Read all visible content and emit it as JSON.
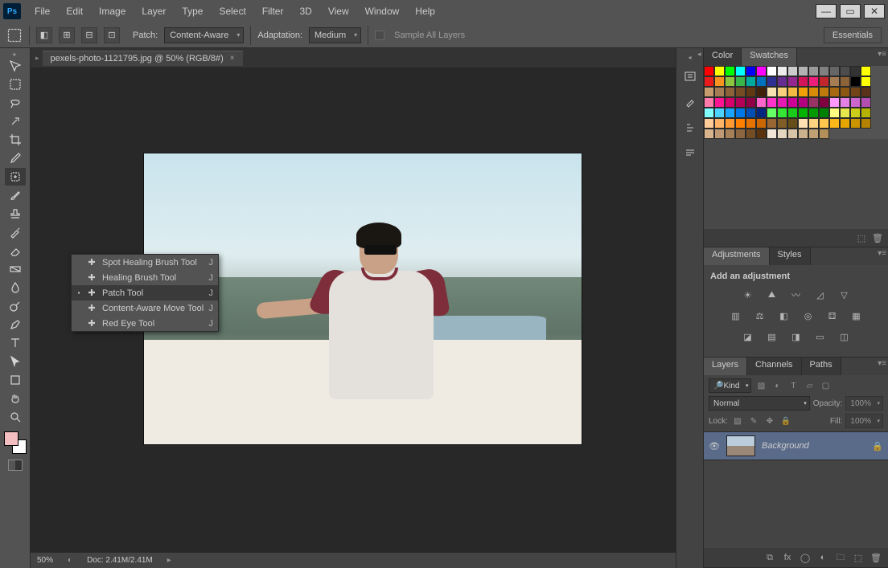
{
  "app": {
    "logo_text": "Ps"
  },
  "menubar": [
    "File",
    "Edit",
    "Image",
    "Layer",
    "Type",
    "Select",
    "Filter",
    "3D",
    "View",
    "Window",
    "Help"
  ],
  "options": {
    "patch_label": "Patch:",
    "patch_value": "Content-Aware",
    "adapt_label": "Adaptation:",
    "adapt_value": "Medium",
    "sample_all_label": "Sample All Layers",
    "essentials": "Essentials"
  },
  "document": {
    "tab_title": "pexels-photo-1121795.jpg @ 50% (RGB/8#)"
  },
  "tool_flyout": {
    "items": [
      {
        "label": "Spot Healing Brush Tool",
        "key": "J",
        "selected": false
      },
      {
        "label": "Healing Brush Tool",
        "key": "J",
        "selected": false
      },
      {
        "label": "Patch Tool",
        "key": "J",
        "selected": true
      },
      {
        "label": "Content-Aware Move Tool",
        "key": "J",
        "selected": false
      },
      {
        "label": "Red Eye Tool",
        "key": "J",
        "selected": false
      }
    ]
  },
  "status": {
    "zoom": "50%",
    "doc_size": "Doc: 2.41M/2.41M"
  },
  "panels": {
    "color_tab": "Color",
    "swatches_tab": "Swatches",
    "adjustments_tab": "Adjustments",
    "styles_tab": "Styles",
    "add_adjustment": "Add an adjustment",
    "layers_tab": "Layers",
    "channels_tab": "Channels",
    "paths_tab": "Paths",
    "kind_label": "Kind",
    "blend_mode": "Normal",
    "opacity_label": "Opacity:",
    "opacity_value": "100%",
    "lock_label": "Lock:",
    "fill_label": "Fill:",
    "fill_value": "100%",
    "layer_name": "Background"
  },
  "swatch_colors": [
    "#ff0000",
    "#ffff00",
    "#00ff00",
    "#00ffff",
    "#0000ff",
    "#ff00ff",
    "#ffffff",
    "#ededed",
    "#cccccc",
    "#b3b3b3",
    "#999999",
    "#808080",
    "#666666",
    "#4d4d4d",
    "#333333",
    "#ffff00",
    "#ea1b1b",
    "#f7931e",
    "#8cc63f",
    "#39b54a",
    "#00a99d",
    "#0071bc",
    "#2e3192",
    "#662d91",
    "#93278f",
    "#d4145a",
    "#ed1e79",
    "#c1272d",
    "#a67c52",
    "#8c6239",
    "#000000",
    "#ffff00",
    "#c69c6d",
    "#a67c52",
    "#8c6239",
    "#754c24",
    "#603813",
    "#42210b",
    "#f9e2b2",
    "#f6d07e",
    "#f4b942",
    "#f2a007",
    "#d88c0a",
    "#bf7a0d",
    "#a66810",
    "#8c5613",
    "#734416",
    "#5a3219",
    "#ff7bac",
    "#ff1493",
    "#d6006c",
    "#b30059",
    "#8f0046",
    "#ff66cc",
    "#ff33cc",
    "#e619b3",
    "#cc0099",
    "#b30080",
    "#993366",
    "#800040",
    "#ff99ff",
    "#e580e5",
    "#cc66cc",
    "#b24db2",
    "#80ffff",
    "#4dd2ff",
    "#1aa3ff",
    "#0077e6",
    "#004db3",
    "#002680",
    "#66ff66",
    "#33e633",
    "#1acc1a",
    "#00b300",
    "#009900",
    "#008000",
    "#ffff80",
    "#e6e64d",
    "#cccc1a",
    "#b3b300",
    "#ffcc99",
    "#ffb366",
    "#ff9933",
    "#ff8000",
    "#e67300",
    "#cc6600",
    "#996633",
    "#805c26",
    "#664d1a",
    "#ffe0b3",
    "#ffd480",
    "#ffc64d",
    "#ffb81a",
    "#e6a600",
    "#cc9400",
    "#b38200",
    "#d9b38c",
    "#bf9973",
    "#a68059",
    "#8c6640",
    "#734d26",
    "#59330d",
    "#f2e6d9",
    "#e6d5bf",
    "#d9c3a6",
    "#ccb28c",
    "#bfa173",
    "#b39059"
  ]
}
